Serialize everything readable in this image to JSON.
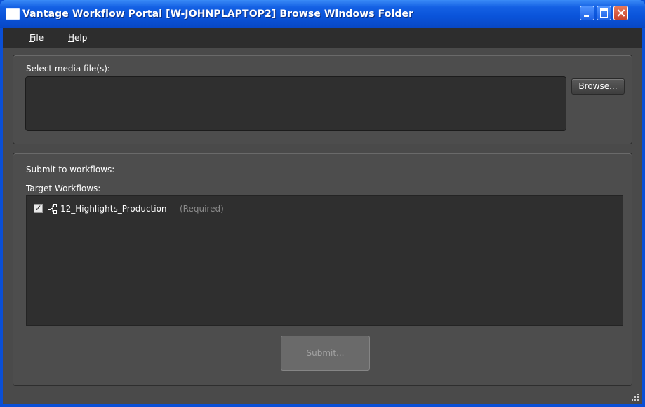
{
  "window": {
    "title": "Vantage Workflow Portal [W-JOHNPLAPTOP2]  Browse Windows Folder",
    "controls": [
      "minimize-icon",
      "maximize-icon",
      "close-icon"
    ]
  },
  "menu": {
    "file_hotkey": "F",
    "file_rest": "ile",
    "help_hotkey": "H",
    "help_rest": "elp"
  },
  "media": {
    "label": "Select media file(s):",
    "browse_label": "Browse..."
  },
  "workflows": {
    "section_label": "Submit to workflows:",
    "target_label": "Target Workflows:",
    "items": [
      {
        "name": "12_Highlights_Production",
        "note": "(Required)",
        "checked": true,
        "icon": "workflow-icon"
      }
    ],
    "submit_label": "Submit..."
  },
  "colors": {
    "titlebar": "#0a53d9",
    "background": "#4a4a4a",
    "menubar": "#2d2d2d",
    "list_bg": "#2f2f2f",
    "text": "#ffffff",
    "muted": "#8a8a8a"
  }
}
